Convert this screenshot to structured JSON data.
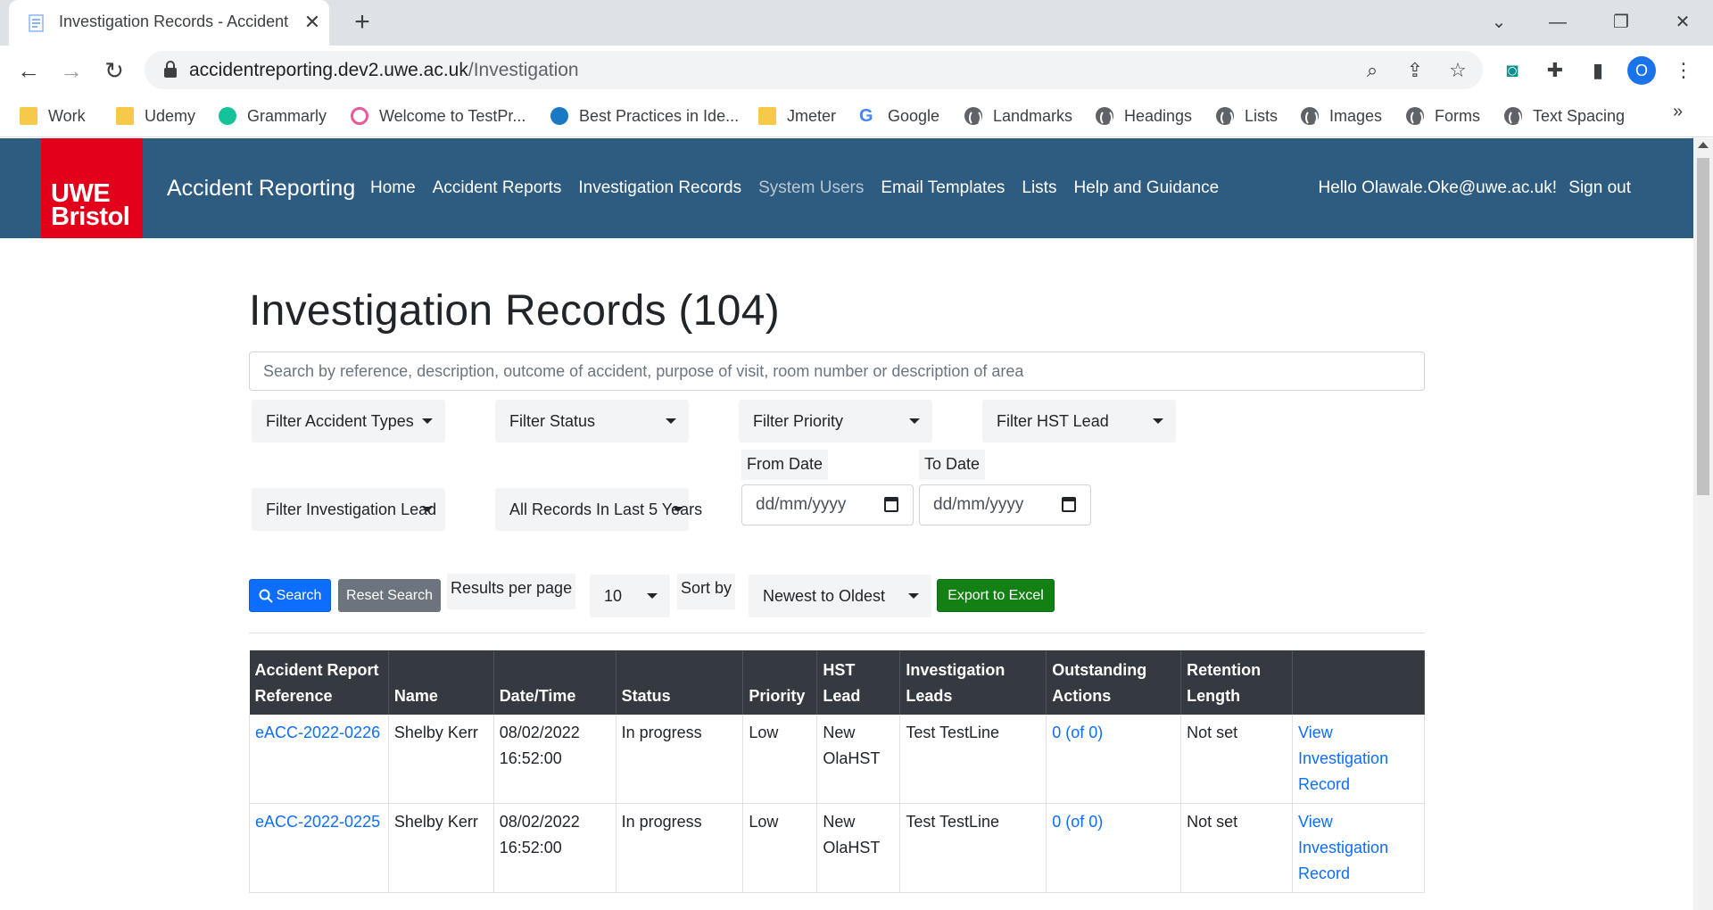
{
  "browser": {
    "tab_title": "Investigation Records - Accident",
    "url_host": "accidentreporting.dev2.uwe.ac.uk",
    "url_path": "/Investigation",
    "profile_initial": "O",
    "bookmarks": [
      "Work",
      "Udemy",
      "Grammarly",
      "Welcome to TestPr...",
      "Best Practices in Ide...",
      "Jmeter",
      "Google",
      "Landmarks",
      "Headings",
      "Lists",
      "Images",
      "Forms",
      "Text Spacing"
    ]
  },
  "app": {
    "logo_line1": "UWE",
    "logo_line2": "Bristol",
    "brand": "Accident Reporting",
    "nav": [
      "Home",
      "Accident Reports",
      "Investigation Records",
      "System Users",
      "Email Templates",
      "Lists",
      "Help and Guidance"
    ],
    "greeting": "Hello Olawale.Oke@uwe.ac.uk!",
    "sign_out": "Sign out"
  },
  "page": {
    "title": "Investigation Records (104)",
    "search_placeholder": "Search by reference, description, outcome of accident, purpose of visit, room number or description of area",
    "filters": {
      "accident_types": "Filter Accident Types",
      "status": "Filter Status",
      "priority": "Filter Priority",
      "hst_lead": "Filter HST Lead",
      "investigation_lead": "Filter Investigation Lead",
      "records_range": "All Records In Last 5 Years"
    },
    "from_date_label": "From Date",
    "to_date_label": "To Date",
    "date_placeholder": "dd/mm/yyyy",
    "search_button": "Search",
    "reset_button": "Reset Search",
    "results_per_page_label": "Results per page",
    "results_per_page_value": "10",
    "sort_label": "Sort by",
    "sort_value": "Newest to Oldest",
    "export_button": "Export to Excel"
  },
  "table": {
    "headers": [
      "Accident Report Reference",
      "Name",
      "Date/Time",
      "Status",
      "Priority",
      "HST Lead",
      "Investigation Leads",
      "Outstanding Actions",
      "Retention Length",
      ""
    ],
    "rows": [
      {
        "ref": "eACC-2022-0226",
        "name": "Shelby Kerr",
        "datetime": "08/02/2022 16:52:00",
        "status": "In progress",
        "priority": "Low",
        "hst_lead": "New OlaHST",
        "inv_leads": "Test TestLine",
        "actions": "0 (of 0)",
        "retention": "Not set",
        "view": "View Investigation Record"
      },
      {
        "ref": "eACC-2022-0225",
        "name": "Shelby Kerr",
        "datetime": "08/02/2022 16:52:00",
        "status": "In progress",
        "priority": "Low",
        "hst_lead": "New OlaHST",
        "inv_leads": "Test TestLine",
        "actions": "0 (of 0)",
        "retention": "Not set",
        "view": "View Investigation Record"
      }
    ]
  }
}
